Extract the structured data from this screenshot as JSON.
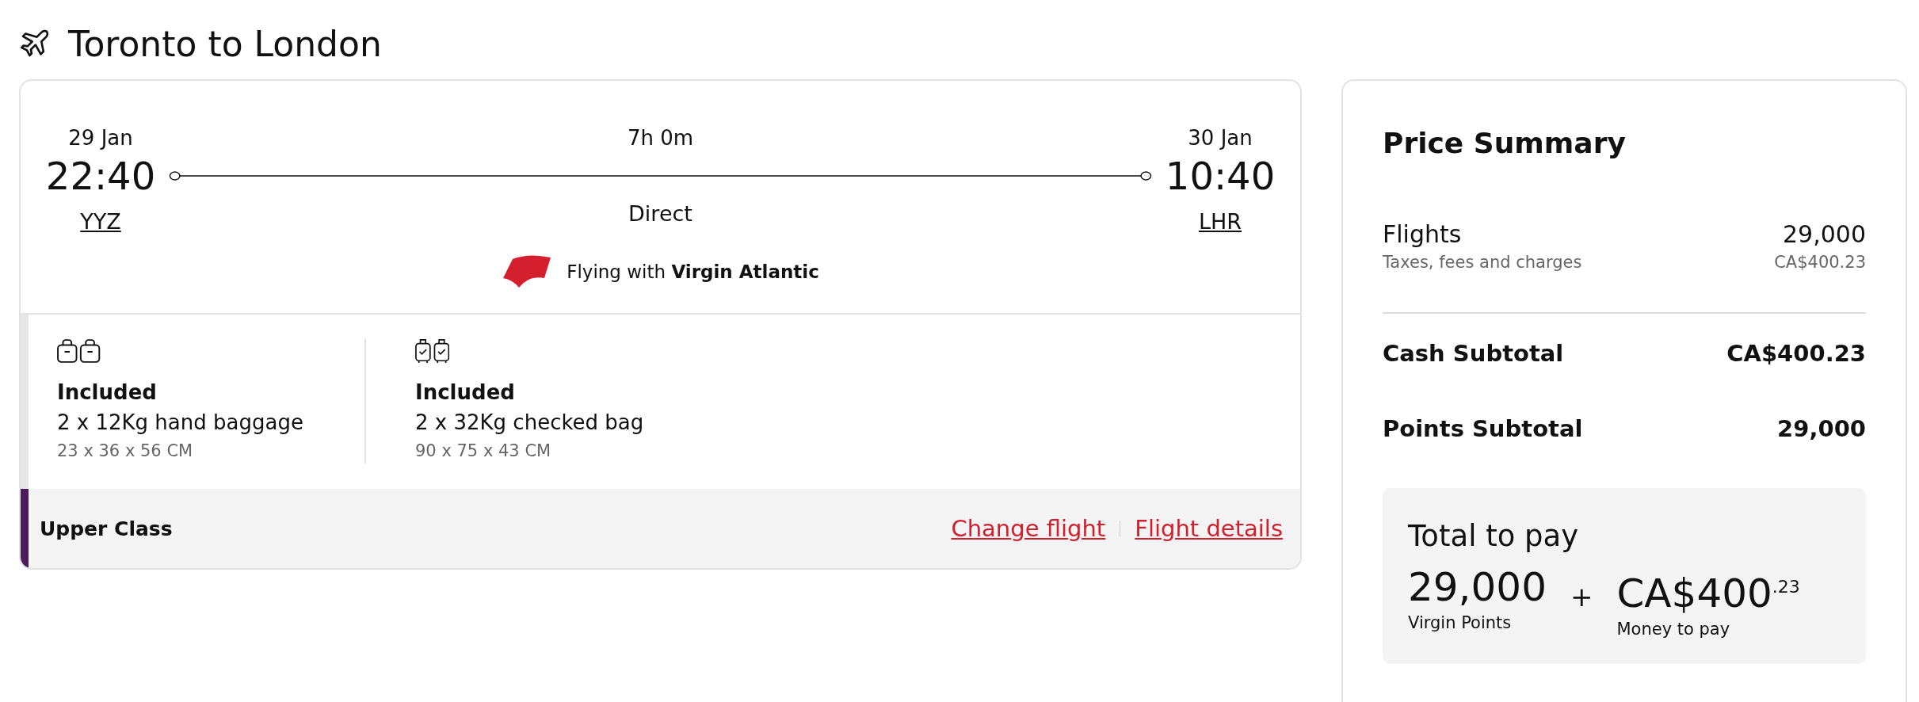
{
  "header": {
    "title": "Toronto to London"
  },
  "flight": {
    "departure": {
      "date": "29 Jan",
      "time": "22:40",
      "airport": "YYZ"
    },
    "duration": "7h 0m",
    "stops": "Direct",
    "arrival": {
      "date": "30 Jan",
      "time": "10:40",
      "airport": "LHR"
    },
    "airline_note": "Flying with **Virgin Atlantic**"
  },
  "baggage": [
    {
      "kind": "hand",
      "status": "Included",
      "allowance": "2 x 12Kg hand baggage",
      "dimensions": "23 x 36 x 56 CM"
    },
    {
      "kind": "checked",
      "status": "Included",
      "allowance": "2 x 32Kg checked bag",
      "dimensions": "90 x 75 x 43 CM"
    }
  ],
  "fare": {
    "cabin": "Upper Class",
    "links": [
      "Change flight",
      "Flight details"
    ]
  },
  "price_summary": {
    "title": "Price Summary",
    "lines": [
      {
        "kind": "item",
        "label": "Flights",
        "value": "29,000"
      },
      {
        "kind": "detail",
        "label": "Taxes, fees and charges",
        "value": "CA$400.23"
      }
    ],
    "subtotals": [
      {
        "label": "Cash Subtotal",
        "value": "CA$400.23"
      },
      {
        "label": "Points Subtotal",
        "value": "29,000"
      }
    ],
    "total": {
      "title": "Total to pay",
      "points": "29,000",
      "points_label": "Virgin Points",
      "plus": "+",
      "money": "CA$400$^{.23}$",
      "money_label": "Money to pay"
    }
  }
}
